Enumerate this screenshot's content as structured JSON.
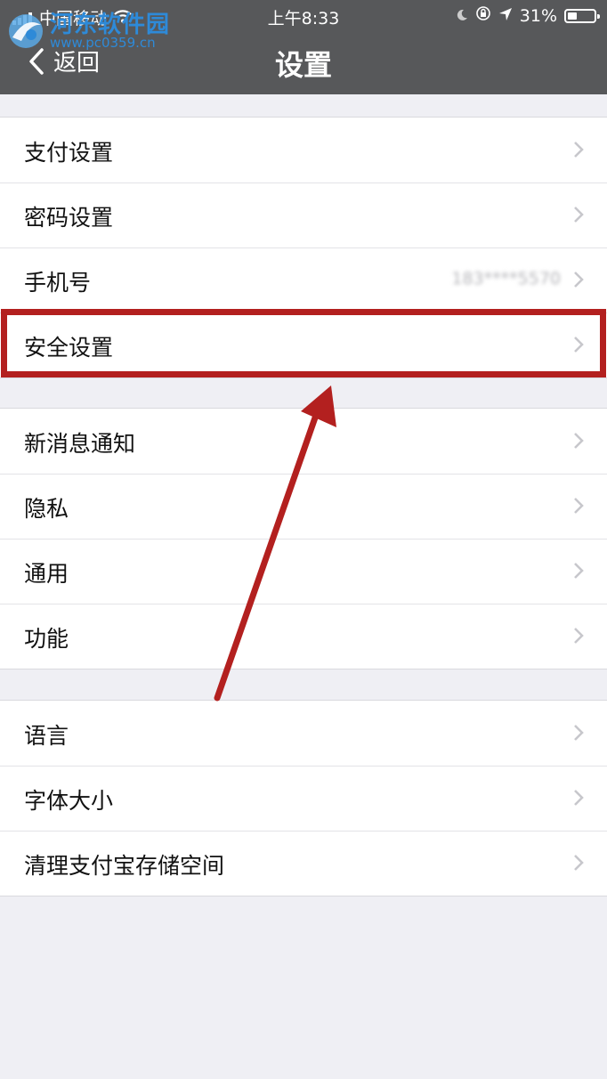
{
  "status_bar": {
    "carrier": "中国移动",
    "time": "上午8:33",
    "battery": "31%",
    "battery_level": 0.31,
    "icons": [
      "signal-icon",
      "wifi-icon",
      "moon-icon",
      "rotation-lock-icon",
      "location-arrow-icon",
      "battery-icon"
    ]
  },
  "watermark": {
    "title": "河东软件园",
    "url": "www.pc0359.cn"
  },
  "nav": {
    "back_label": "返回",
    "title": "设置"
  },
  "groups": [
    {
      "items": [
        {
          "label": "支付设置"
        },
        {
          "label": "密码设置"
        },
        {
          "label": "手机号",
          "value": "183****5570"
        },
        {
          "label": "安全设置"
        }
      ]
    },
    {
      "items": [
        {
          "label": "新消息通知"
        },
        {
          "label": "隐私"
        },
        {
          "label": "通用"
        },
        {
          "label": "功能"
        }
      ]
    },
    {
      "items": [
        {
          "label": "语言"
        },
        {
          "label": "字体大小"
        },
        {
          "label": "清理支付宝存储空间"
        }
      ]
    }
  ],
  "annotation": {
    "highlighted_item": "安全设置",
    "color": "#b3201f"
  }
}
